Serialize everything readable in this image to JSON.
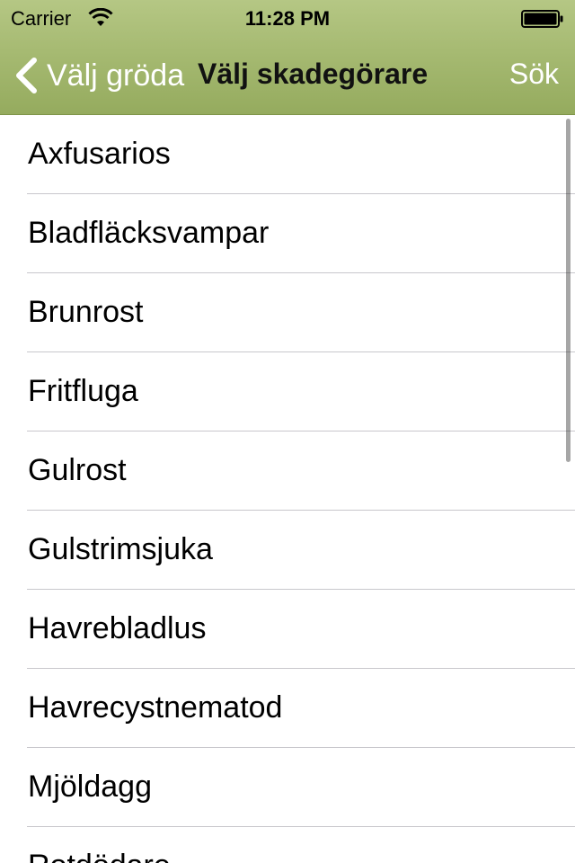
{
  "status_bar": {
    "carrier": "Carrier",
    "time": "11:28 PM"
  },
  "nav_bar": {
    "back_label": "Välj gröda",
    "title": "Välj skadegörare",
    "search_label": "Sök"
  },
  "list": {
    "items": [
      {
        "label": "Axfusarios"
      },
      {
        "label": "Bladfläcksvampar"
      },
      {
        "label": "Brunrost"
      },
      {
        "label": "Fritfluga"
      },
      {
        "label": "Gulrost"
      },
      {
        "label": "Gulstrimsjuka"
      },
      {
        "label": "Havrebladlus"
      },
      {
        "label": "Havrecystnematod"
      },
      {
        "label": "Mjöldagg"
      },
      {
        "label": "Rotdödare"
      }
    ]
  },
  "colors": {
    "header_gradient_top": "#b5c784",
    "header_gradient_bottom": "#95ab5e",
    "separator": "#c8c7cc"
  },
  "icons": {
    "wifi": "wifi-icon",
    "battery": "battery-icon",
    "back": "chevron-left-icon"
  }
}
